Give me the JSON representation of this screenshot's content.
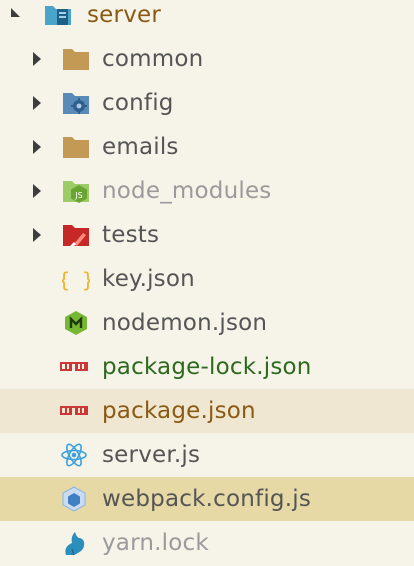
{
  "tree": {
    "root": {
      "label": "server",
      "color": "#8a5a12"
    },
    "items": [
      {
        "label": "common",
        "color": "#555555",
        "icon": "folder-icon",
        "icon_color": "#c29a55"
      },
      {
        "label": "config",
        "color": "#555555",
        "icon": "folder-config-icon",
        "icon_color": "#5a8ab8"
      },
      {
        "label": "emails",
        "color": "#555555",
        "icon": "folder-icon",
        "icon_color": "#c29a55"
      },
      {
        "label": "node_modules",
        "color": "#9a9a9a",
        "icon": "folder-nodejs-icon",
        "icon_color": "#7cb342"
      },
      {
        "label": "tests",
        "color": "#555555",
        "icon": "folder-test-icon",
        "icon_color": "#c62828"
      },
      {
        "label": "key.json",
        "color": "#555555",
        "icon": "json-braces-icon",
        "icon_color": "#f0b429"
      },
      {
        "label": "nodemon.json",
        "color": "#555555",
        "icon": "nodemon-icon",
        "icon_color": "#76b833"
      },
      {
        "label": "package-lock.json",
        "color": "#2d6a1e",
        "icon": "npm-icon",
        "icon_color": "#cb3837"
      },
      {
        "label": "package.json",
        "color": "#8a5a12",
        "icon": "npm-icon",
        "icon_color": "#cb3837"
      },
      {
        "label": "server.js",
        "color": "#555555",
        "icon": "react-icon",
        "icon_color": "#3aa0dc"
      },
      {
        "label": "webpack.config.js",
        "color": "#555555",
        "icon": "webpack-icon",
        "icon_color": "#8ab4e0"
      },
      {
        "label": "yarn.lock",
        "color": "#9a9a9a",
        "icon": "yarn-icon",
        "icon_color": "#2c8ebb"
      }
    ]
  }
}
